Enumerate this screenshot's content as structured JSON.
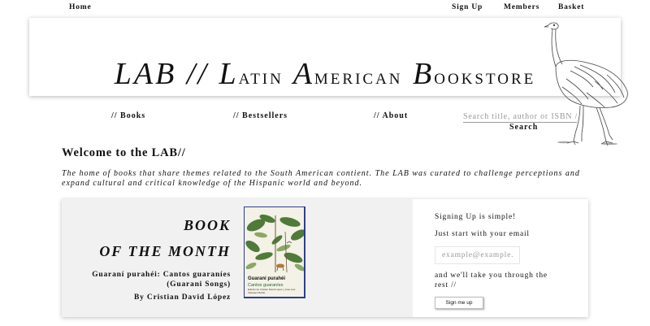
{
  "top_nav": {
    "home": "Home",
    "sign_up": "Sign Up",
    "members": "Members",
    "basket": "Basket"
  },
  "banner": {
    "lab": "LAB //",
    "l": "L",
    "atin": "ATIN",
    "a": "A",
    "merican": "MERICAN",
    "b": "B",
    "ookstore": "OOKSTORE"
  },
  "main_nav": {
    "books": "// Books",
    "bestsellers": "// Bestsellers",
    "about": "// About",
    "search_placeholder": "Search title, author or ISBN //",
    "search_button": "Search"
  },
  "welcome": {
    "heading": "Welcome to the LAB//",
    "intro": "The home of books that share themes related to the South American contient. The LAB was curated to challenge perceptions and expand cultural and critical knowledge of the Hispanic world and beyond."
  },
  "book_of_month": {
    "line1": "BOOK",
    "line2": "OF THE MONTH",
    "title_line1": "Guaraní purahéi: Cantos guaraníes",
    "title_line2": "(Guarani Songs)",
    "author": "By Cristian David López",
    "cover_title": "Guaraní purahéi",
    "cover_subtitle": "Cantos guaraníes",
    "cover_credit": "Edición de Cristian David López y José Luis Vázquez Morillo"
  },
  "signup": {
    "line1": "Signing Up is simple!",
    "line2": "Just start with your email",
    "email_placeholder": "example@example.",
    "line3": "and we'll take you through the rest //",
    "button": "Sign me up"
  },
  "colors": {
    "card_left_bg": "#f1f1f1",
    "cover_border": "#2b3f8e",
    "cover_subtitle": "#1c6b3a"
  },
  "icons": {
    "banner_illustration": "rhea-bird-icon",
    "cover_art": "jungle-cover-illustration"
  }
}
